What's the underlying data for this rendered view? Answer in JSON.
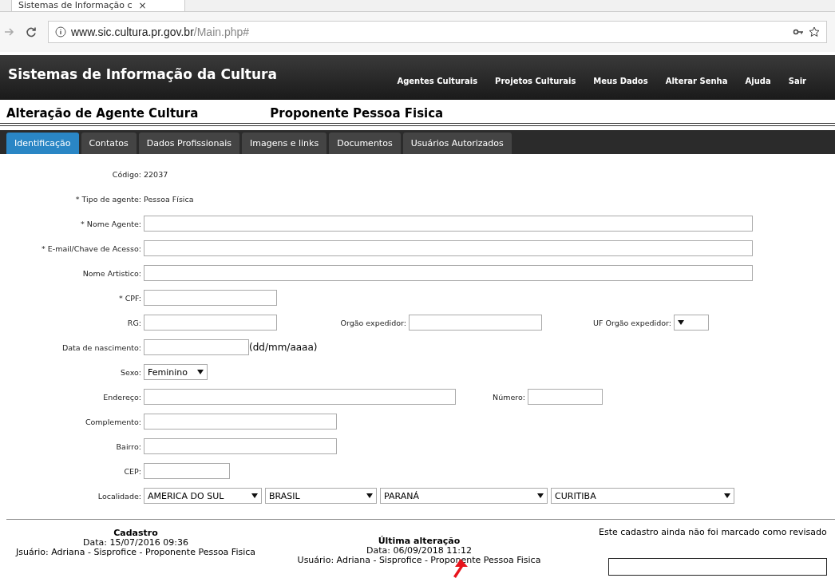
{
  "browser": {
    "tab_title": "Sistemas de Informação c",
    "tab_close": "×",
    "url_host": "www.sic.cultura.pr.gov.br",
    "url_path": "/Main.php#"
  },
  "header": {
    "title": "Sistemas de Informação da Cultura",
    "nav": [
      "Agentes Culturais",
      "Projetos Culturais",
      "Meus Dados",
      "Alterar Senha",
      "Ajuda",
      "Sair"
    ]
  },
  "page_title": {
    "left": "Alteração de Agente Cultura",
    "right": "Proponente Pessoa Fisica"
  },
  "tabs": [
    {
      "label": "Identificação",
      "selected": true
    },
    {
      "label": "Contatos",
      "selected": false
    },
    {
      "label": "Dados Profissionais",
      "selected": false
    },
    {
      "label": "Imagens e links",
      "selected": false
    },
    {
      "label": "Documentos",
      "selected": false
    },
    {
      "label": "Usuários Autorizados",
      "selected": false
    }
  ],
  "form_rows": [
    {
      "fields": [
        {
          "kind": "text",
          "label": "Código:",
          "value": "22037"
        }
      ]
    },
    {
      "fields": [
        {
          "kind": "text",
          "label": "* Tipo de agente:",
          "value": "Pessoa Física"
        }
      ]
    },
    {
      "fields": [
        {
          "kind": "input",
          "label": "* Nome Agente:"
        }
      ]
    },
    {
      "fields": [
        {
          "kind": "input",
          "label": "* E-mail/Chave de Acesso:"
        }
      ]
    },
    {
      "fields": [
        {
          "kind": "input",
          "label": "Nome Artistico:"
        }
      ]
    },
    {
      "fields": [
        {
          "kind": "input",
          "label": "* CPF:"
        }
      ]
    },
    {
      "fields": [
        {
          "kind": "input",
          "label": "RG:"
        },
        {
          "kind": "input",
          "label": "Orgão expedidor:"
        },
        {
          "kind": "select",
          "label": "UF Orgão expedidor:"
        }
      ]
    },
    {
      "fields": [
        {
          "kind": "input",
          "label": "Data de nascimento:",
          "hint": "(dd/mm/aaaa)"
        }
      ]
    },
    {
      "fields": [
        {
          "kind": "select",
          "label": "Sexo:",
          "value": "Feminino"
        }
      ]
    },
    {
      "fields": [
        {
          "kind": "input",
          "label": "Endereço:"
        },
        {
          "kind": "input",
          "label": "Número:"
        }
      ]
    },
    {
      "fields": [
        {
          "kind": "input",
          "label": "Complemento:"
        }
      ]
    },
    {
      "fields": [
        {
          "kind": "input",
          "label": "Bairro:"
        }
      ]
    },
    {
      "fields": [
        {
          "kind": "input",
          "label": "CEP:"
        }
      ]
    },
    {
      "fields": [
        {
          "kind": "selects",
          "label": "Localidade:",
          "options": [
            "AMERICA DO SUL",
            "BRASIL",
            "PARANÁ",
            "CURITIBA"
          ]
        }
      ]
    }
  ],
  "footer": {
    "cadastro": {
      "title": "Cadastro",
      "date": "Data: 15/07/2016 09:36",
      "user": "Jsuário: Adriana - Sisprofice - Proponente Pessoa Fisica"
    },
    "alteracao": {
      "title": "Última alteração",
      "date": "Data: 06/09/2018 11:12",
      "user": "Usuário: Adriana - Sisprofice - Proponente Pessoa Fisica"
    },
    "revisao": "Este cadastro ainda não foi marcado como revisado"
  }
}
